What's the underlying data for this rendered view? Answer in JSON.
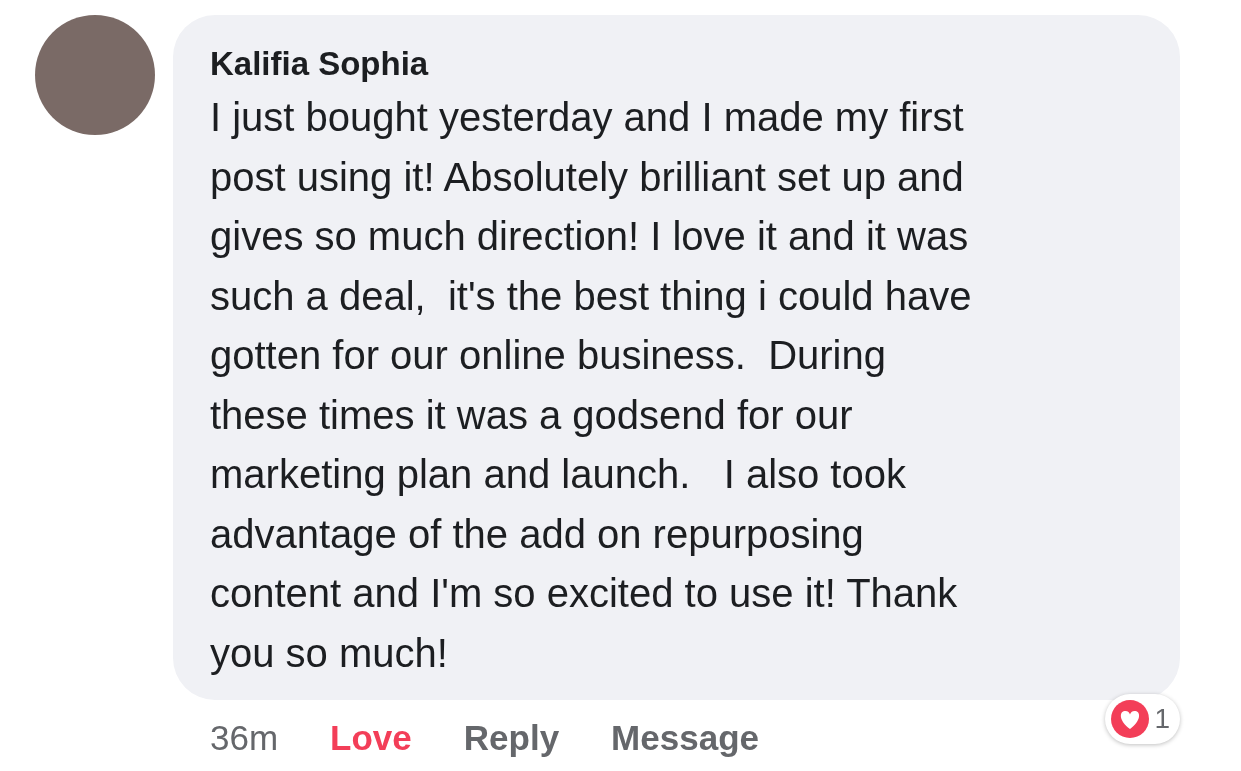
{
  "comment": {
    "author": "Kalifia Sophia",
    "text": "I just bought yesterday and I made my first\npost using it! Absolutely brilliant set up and\ngives so much direction! I love it and it was\nsuch a deal,  it's the best thing i could have\ngotten for our online business.  During\nthese times it was a godsend for our\nmarketing plan and launch.   I also took\nadvantage of the add on repurposing\ncontent and I'm so excited to use it! Thank\nyou so much!",
    "time": "36m",
    "actions": [
      {
        "label": "Love",
        "selected": true
      },
      {
        "label": "Reply",
        "selected": false
      },
      {
        "label": "Message",
        "selected": false
      }
    ],
    "reactions": {
      "count": "1"
    }
  }
}
